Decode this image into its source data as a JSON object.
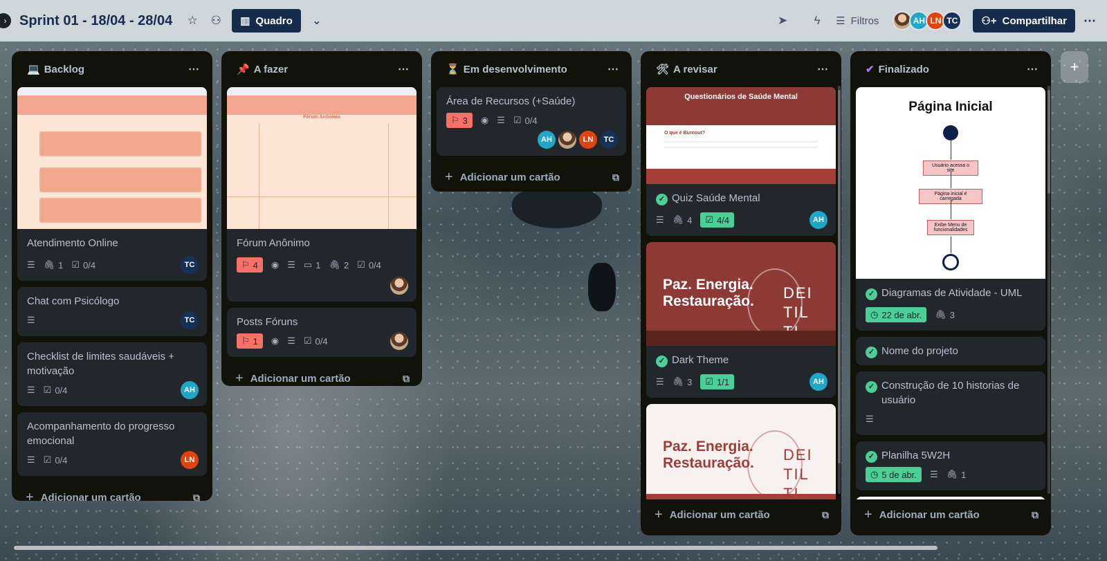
{
  "header": {
    "board_title": "Sprint 01 - 18/04 - 28/04",
    "view_label": "Quadro",
    "filters_label": "Filtros",
    "share_label": "Compartilhar",
    "members": [
      "AH",
      "LN",
      "TC"
    ]
  },
  "lists": [
    {
      "emoji": "💻",
      "name": "Backlog",
      "add_label": "Adicionar um cartão",
      "cards": [
        {
          "title": "Atendimento Online",
          "attachments": "1",
          "checklist": "0/4",
          "member": "TC"
        },
        {
          "title": "Chat com Psicólogo",
          "member": "TC"
        },
        {
          "title": "Checklist de limites saudáveis + motivação",
          "checklist": "0/4",
          "member": "AH"
        },
        {
          "title": "Acompanhamento do progresso emocional",
          "checklist": "0/4",
          "member": "LN"
        }
      ]
    },
    {
      "emoji": "📌",
      "name": "A fazer",
      "add_label": "Adicionar um cartão",
      "cards": [
        {
          "title": "Fórum Anônimo",
          "priority": "4",
          "comments": "1",
          "attachments": "2",
          "checklist": "0/4"
        },
        {
          "title": "Posts Fóruns",
          "priority": "1",
          "checklist": "0/4"
        }
      ],
      "cover_label": "Fórum Anônimo"
    },
    {
      "emoji": "⏳",
      "name": "Em desenvolvimento",
      "add_label": "Adicionar um cartão",
      "cards": [
        {
          "title": "Área de Recursos (+Saúde)",
          "priority": "3",
          "checklist": "0/4",
          "members": [
            "AH",
            "LN",
            "TC"
          ]
        }
      ]
    },
    {
      "emoji": "🛠",
      "name": "A revisar",
      "add_label": "Adicionar um cartão",
      "cards": [
        {
          "title": "Quiz Saúde Mental",
          "attachments": "4",
          "checklist": "4/4",
          "member": "AH",
          "cover_title": "Questionários de Saúde Mental",
          "cover_sub": "O que é Burnout?"
        },
        {
          "title": "Dark Theme",
          "attachments": "3",
          "checklist": "1/1",
          "member": "AH",
          "cover_hero": "Paz. Energia. Restauração.",
          "cover_logo": "DEI TIL TI"
        },
        {
          "cover_hero": "Paz. Energia. Restauração.",
          "cover_logo": "DEI TIL TI"
        }
      ]
    },
    {
      "emoji": "✔",
      "name": "Finalizado",
      "add_label": "Adicionar um cartão",
      "cards": [
        {
          "title": "Diagramas de Atividade - UML",
          "due": "22 de abr.",
          "attachments": "3"
        },
        {
          "title": "Nome do projeto"
        },
        {
          "title": "Construção de 10 historias de usuário"
        },
        {
          "title": "Planilha 5W2H",
          "due": "5 de abr.",
          "attachments": "1"
        }
      ],
      "diagram": {
        "title": "Página Inicial",
        "nodes": [
          "Usuário acessa o site",
          "Página inicial é carregada",
          "Exibe Menu de funcionalidades"
        ]
      }
    }
  ]
}
